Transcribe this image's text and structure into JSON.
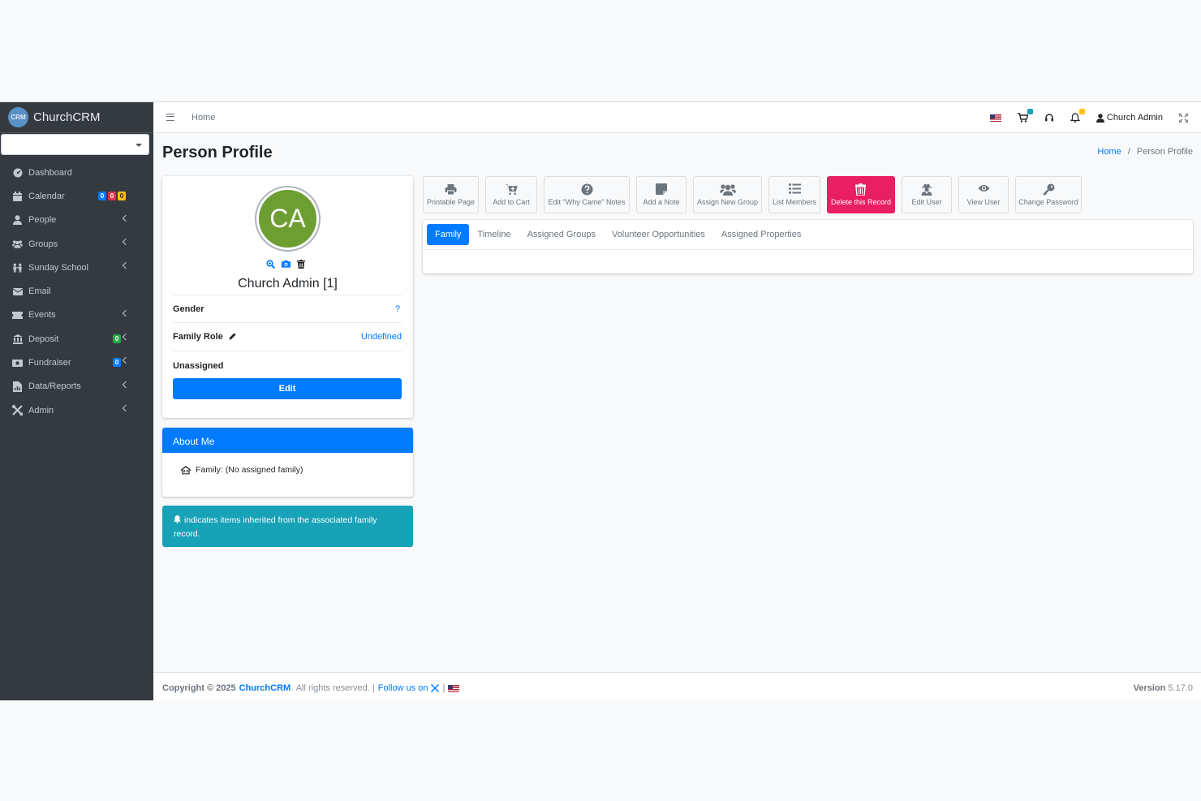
{
  "sidebar": {
    "brand_logo": "CRM",
    "brand": "ChurchCRM",
    "items": [
      {
        "label": "Dashboard"
      },
      {
        "label": "Calendar",
        "badges": [
          "0",
          "0",
          "0"
        ]
      },
      {
        "label": "People"
      },
      {
        "label": "Groups"
      },
      {
        "label": "Sunday School"
      },
      {
        "label": "Email"
      },
      {
        "label": "Events"
      },
      {
        "label": "Deposit",
        "badge": "0"
      },
      {
        "label": "Fundraiser",
        "badge": "0"
      },
      {
        "label": "Data/Reports"
      },
      {
        "label": "Admin"
      }
    ]
  },
  "navbar": {
    "home": "Home",
    "user": "Church Admin",
    "badge_colors": {
      "cart": "#17a2b8",
      "bell": "#ffc107"
    }
  },
  "page": {
    "title": "Person Profile",
    "breadcrumb_home": "Home",
    "breadcrumb_sep": "/",
    "breadcrumb_current": "Person Profile"
  },
  "profile": {
    "initials": "CA",
    "name": "Church Admin [1]",
    "gender_label": "Gender",
    "gender_value": "?",
    "family_role_label": "Family Role",
    "family_role_value": "Undefined",
    "unassigned": "Unassigned",
    "edit_button": "Edit"
  },
  "about": {
    "title": "About Me",
    "family": "Family: (No assigned family)"
  },
  "alert": {
    "text": "indicates items inherited from the associated family record."
  },
  "toolbar": {
    "printable": "Printable Page",
    "cart": "Add to Cart",
    "why_came": "Edit \"Why Came\" Notes",
    "note": "Add a Note",
    "assign_group": "Assign New Group",
    "list_members": "List Members",
    "delete": "Delete this Record",
    "edit_user": "Edit User",
    "view_user": "View User",
    "change_password": "Change Password"
  },
  "tabs": [
    "Family",
    "Timeline",
    "Assigned Groups",
    "Volunteer Opportunities",
    "Assigned Properties"
  ],
  "footer": {
    "copyright": "Copyright © 2025",
    "brand": "ChurchCRM",
    "rights": ". All rights reserved. |",
    "follow": "Follow us on",
    "pipe": "|",
    "version_label": "Version",
    "version": "5.17.0"
  }
}
